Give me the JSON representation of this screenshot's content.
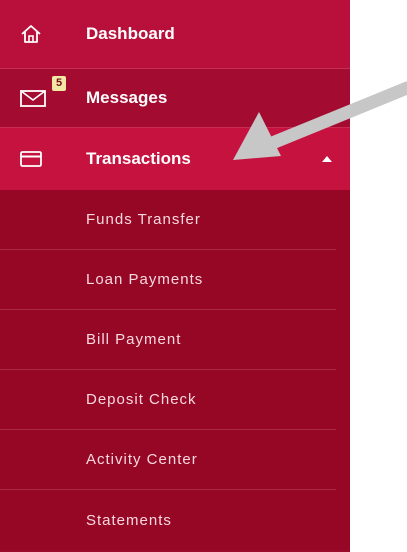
{
  "nav": {
    "dashboard": {
      "label": "Dashboard",
      "icon": "home-icon"
    },
    "messages": {
      "label": "Messages",
      "icon": "envelope-icon",
      "badge": "5"
    },
    "transactions": {
      "label": "Transactions",
      "icon": "card-icon",
      "expanded": true
    },
    "submenu": [
      {
        "label": "Funds Transfer"
      },
      {
        "label": "Loan Payments"
      },
      {
        "label": "Bill Payment"
      },
      {
        "label": "Deposit Check"
      },
      {
        "label": "Activity Center"
      },
      {
        "label": "Statements"
      }
    ]
  },
  "colors": {
    "sidebar": "#9c0a2c",
    "active": "#c6123f",
    "badge": "#f3e7a4",
    "arrow": "#c7c7c7"
  }
}
